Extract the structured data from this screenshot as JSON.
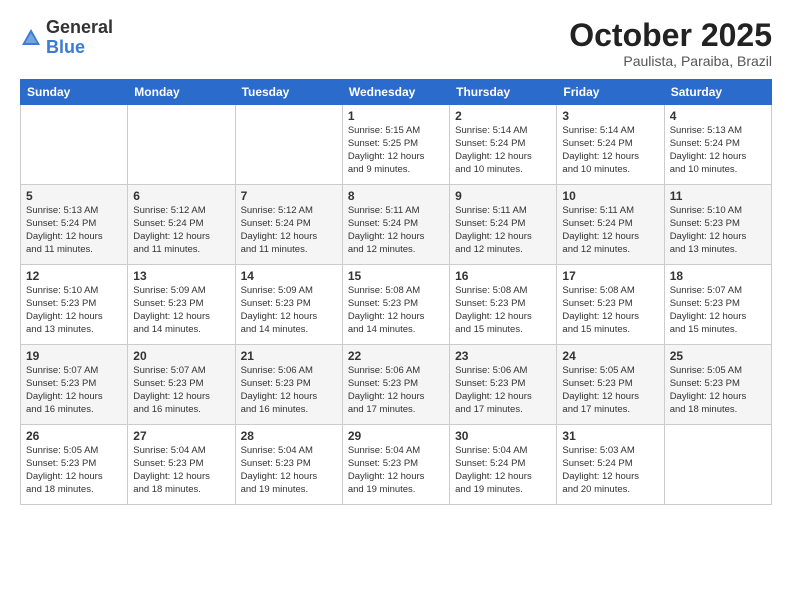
{
  "header": {
    "logo_general": "General",
    "logo_blue": "Blue",
    "month_title": "October 2025",
    "location": "Paulista, Paraiba, Brazil"
  },
  "weekdays": [
    "Sunday",
    "Monday",
    "Tuesday",
    "Wednesday",
    "Thursday",
    "Friday",
    "Saturday"
  ],
  "weeks": [
    [
      {
        "day": "",
        "info": ""
      },
      {
        "day": "",
        "info": ""
      },
      {
        "day": "",
        "info": ""
      },
      {
        "day": "1",
        "info": "Sunrise: 5:15 AM\nSunset: 5:25 PM\nDaylight: 12 hours\nand 9 minutes."
      },
      {
        "day": "2",
        "info": "Sunrise: 5:14 AM\nSunset: 5:24 PM\nDaylight: 12 hours\nand 10 minutes."
      },
      {
        "day": "3",
        "info": "Sunrise: 5:14 AM\nSunset: 5:24 PM\nDaylight: 12 hours\nand 10 minutes."
      },
      {
        "day": "4",
        "info": "Sunrise: 5:13 AM\nSunset: 5:24 PM\nDaylight: 12 hours\nand 10 minutes."
      }
    ],
    [
      {
        "day": "5",
        "info": "Sunrise: 5:13 AM\nSunset: 5:24 PM\nDaylight: 12 hours\nand 11 minutes."
      },
      {
        "day": "6",
        "info": "Sunrise: 5:12 AM\nSunset: 5:24 PM\nDaylight: 12 hours\nand 11 minutes."
      },
      {
        "day": "7",
        "info": "Sunrise: 5:12 AM\nSunset: 5:24 PM\nDaylight: 12 hours\nand 11 minutes."
      },
      {
        "day": "8",
        "info": "Sunrise: 5:11 AM\nSunset: 5:24 PM\nDaylight: 12 hours\nand 12 minutes."
      },
      {
        "day": "9",
        "info": "Sunrise: 5:11 AM\nSunset: 5:24 PM\nDaylight: 12 hours\nand 12 minutes."
      },
      {
        "day": "10",
        "info": "Sunrise: 5:11 AM\nSunset: 5:24 PM\nDaylight: 12 hours\nand 12 minutes."
      },
      {
        "day": "11",
        "info": "Sunrise: 5:10 AM\nSunset: 5:23 PM\nDaylight: 12 hours\nand 13 minutes."
      }
    ],
    [
      {
        "day": "12",
        "info": "Sunrise: 5:10 AM\nSunset: 5:23 PM\nDaylight: 12 hours\nand 13 minutes."
      },
      {
        "day": "13",
        "info": "Sunrise: 5:09 AM\nSunset: 5:23 PM\nDaylight: 12 hours\nand 14 minutes."
      },
      {
        "day": "14",
        "info": "Sunrise: 5:09 AM\nSunset: 5:23 PM\nDaylight: 12 hours\nand 14 minutes."
      },
      {
        "day": "15",
        "info": "Sunrise: 5:08 AM\nSunset: 5:23 PM\nDaylight: 12 hours\nand 14 minutes."
      },
      {
        "day": "16",
        "info": "Sunrise: 5:08 AM\nSunset: 5:23 PM\nDaylight: 12 hours\nand 15 minutes."
      },
      {
        "day": "17",
        "info": "Sunrise: 5:08 AM\nSunset: 5:23 PM\nDaylight: 12 hours\nand 15 minutes."
      },
      {
        "day": "18",
        "info": "Sunrise: 5:07 AM\nSunset: 5:23 PM\nDaylight: 12 hours\nand 15 minutes."
      }
    ],
    [
      {
        "day": "19",
        "info": "Sunrise: 5:07 AM\nSunset: 5:23 PM\nDaylight: 12 hours\nand 16 minutes."
      },
      {
        "day": "20",
        "info": "Sunrise: 5:07 AM\nSunset: 5:23 PM\nDaylight: 12 hours\nand 16 minutes."
      },
      {
        "day": "21",
        "info": "Sunrise: 5:06 AM\nSunset: 5:23 PM\nDaylight: 12 hours\nand 16 minutes."
      },
      {
        "day": "22",
        "info": "Sunrise: 5:06 AM\nSunset: 5:23 PM\nDaylight: 12 hours\nand 17 minutes."
      },
      {
        "day": "23",
        "info": "Sunrise: 5:06 AM\nSunset: 5:23 PM\nDaylight: 12 hours\nand 17 minutes."
      },
      {
        "day": "24",
        "info": "Sunrise: 5:05 AM\nSunset: 5:23 PM\nDaylight: 12 hours\nand 17 minutes."
      },
      {
        "day": "25",
        "info": "Sunrise: 5:05 AM\nSunset: 5:23 PM\nDaylight: 12 hours\nand 18 minutes."
      }
    ],
    [
      {
        "day": "26",
        "info": "Sunrise: 5:05 AM\nSunset: 5:23 PM\nDaylight: 12 hours\nand 18 minutes."
      },
      {
        "day": "27",
        "info": "Sunrise: 5:04 AM\nSunset: 5:23 PM\nDaylight: 12 hours\nand 18 minutes."
      },
      {
        "day": "28",
        "info": "Sunrise: 5:04 AM\nSunset: 5:23 PM\nDaylight: 12 hours\nand 19 minutes."
      },
      {
        "day": "29",
        "info": "Sunrise: 5:04 AM\nSunset: 5:23 PM\nDaylight: 12 hours\nand 19 minutes."
      },
      {
        "day": "30",
        "info": "Sunrise: 5:04 AM\nSunset: 5:24 PM\nDaylight: 12 hours\nand 19 minutes."
      },
      {
        "day": "31",
        "info": "Sunrise: 5:03 AM\nSunset: 5:24 PM\nDaylight: 12 hours\nand 20 minutes."
      },
      {
        "day": "",
        "info": ""
      }
    ]
  ]
}
